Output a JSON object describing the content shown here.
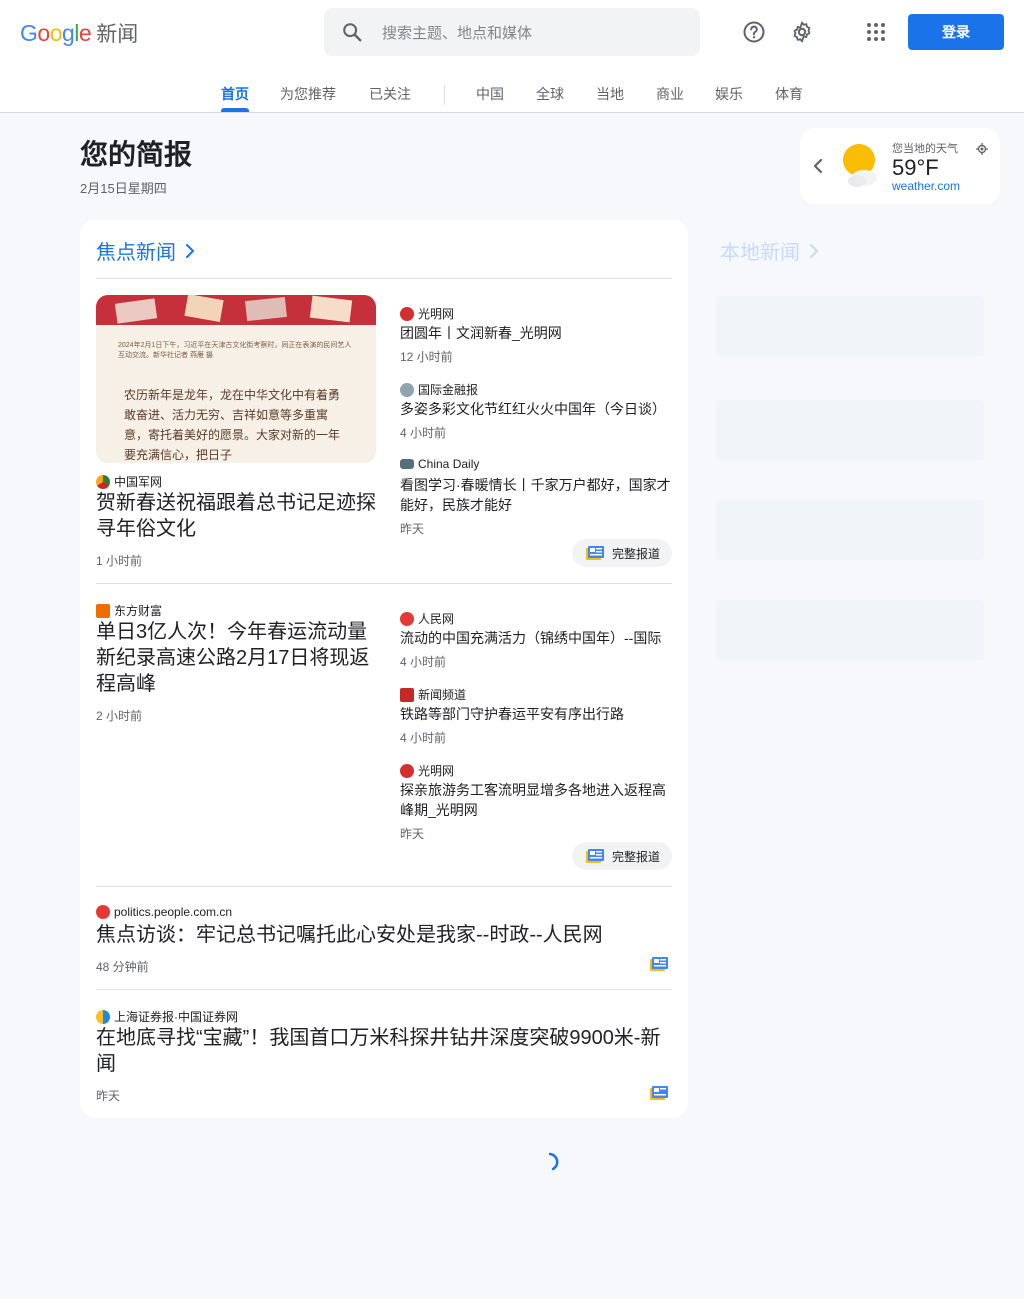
{
  "header": {
    "logo_google": "Google",
    "logo_news": "新闻",
    "search_placeholder": "搜索主题、地点和媒体",
    "login_label": "登录",
    "icons": [
      "search-icon",
      "help-icon",
      "settings-icon",
      "apps-icon"
    ]
  },
  "tabs": [
    "首页",
    "为您推荐",
    "已关注",
    "中国",
    "全球",
    "当地",
    "商业",
    "娱乐",
    "体育"
  ],
  "briefing": {
    "title": "您的简报",
    "date": "2月15日星期四"
  },
  "weather": {
    "label": "您当地的天气",
    "temperature": "59°F",
    "source": "weather.com"
  },
  "top_stories": {
    "heading": "焦点新闻",
    "full_coverage_label": "完整报道",
    "thumb_text": "2024年2月1日下午，习近平在天津古文化街考察时，同正在表演的民间艺人互动交流。新华社记者 燕雁 摄",
    "thumb_body": "农历新年是龙年，龙在中华文化中有着勇敢奋进、活力无穷、吉祥如意等多重寓意，寄托着美好的愿景。大家对新的一年要充满信心，把日子",
    "cluster1": {
      "main": {
        "source": "中国军网",
        "title": "贺新春送祝福跟着总书记足迹探寻年俗文化",
        "time": "1 小时前"
      },
      "related": [
        {
          "source": "光明网",
          "title": "团圆年丨文润新春_光明网",
          "time": "12 小时前"
        },
        {
          "source": "国际金融报",
          "title": "多姿多彩文化节红红火火中国年（今日谈）",
          "time": "4 小时前"
        },
        {
          "source": "China Daily",
          "title": "看图学习·春暖情长丨千家万户都好，国家才能好，民族才能好",
          "time": "昨天"
        }
      ]
    },
    "cluster2": {
      "main": {
        "source": "东方财富",
        "title": "单日3亿人次！今年春运流动量新纪录高速公路2月17日将现返程高峰",
        "time": "2 小时前"
      },
      "related": [
        {
          "source": "人民网",
          "title": "流动的中国充满活力（锦绣中国年）--国际",
          "time": "4 小时前"
        },
        {
          "source": "新闻频道",
          "title": "铁路等部门守护春运平安有序出行路",
          "time": "4 小时前"
        },
        {
          "source": "光明网",
          "title": "探亲旅游务工客流明显增多各地进入返程高峰期_光明网",
          "time": "昨天"
        }
      ]
    },
    "single1": {
      "source": "politics.people.com.cn",
      "title": "焦点访谈：牢记总书记嘱托此心安处是我家--时政--人民网",
      "time": "48 分钟前"
    },
    "single2": {
      "source": "上海证券报·中国证券网",
      "title": "在地底寻找“宝藏”！我国首口万米科探井钻井深度突破9900米-新闻",
      "time": "昨天"
    }
  },
  "local_news": {
    "heading": "本地新闻"
  },
  "colors": {
    "accent": "#1a73e8",
    "background": "#f6f8fc"
  }
}
